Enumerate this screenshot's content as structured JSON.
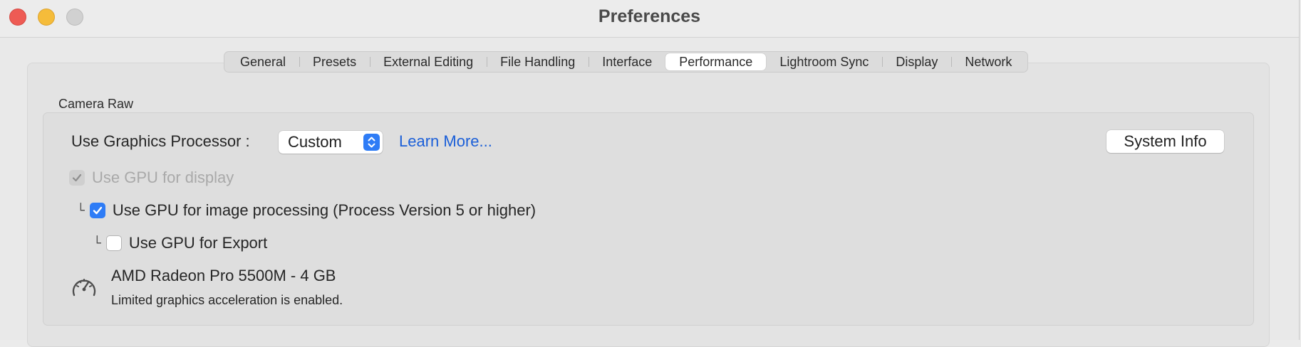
{
  "window": {
    "title": "Preferences",
    "controls": {
      "close_color": "#ee5b54",
      "minimize_color": "#f5bc3a",
      "zoom_color": "#d1d1d1"
    }
  },
  "tabs": [
    {
      "label": "General",
      "active": false
    },
    {
      "label": "Presets",
      "active": false
    },
    {
      "label": "External Editing",
      "active": false
    },
    {
      "label": "File Handling",
      "active": false
    },
    {
      "label": "Interface",
      "active": false
    },
    {
      "label": "Performance",
      "active": true
    },
    {
      "label": "Lightroom Sync",
      "active": false
    },
    {
      "label": "Display",
      "active": false
    },
    {
      "label": "Network",
      "active": false
    }
  ],
  "camera_raw": {
    "group_label": "Camera Raw",
    "graphics_processor": {
      "label": "Use Graphics Processor :",
      "selected": "Custom",
      "learn_more": "Learn More...",
      "system_info": "System Info"
    },
    "options": {
      "display": {
        "label": "Use GPU for display",
        "checked": true,
        "enabled": false
      },
      "image_processing": {
        "label": "Use GPU for image processing (Process Version 5 or higher)",
        "checked": true,
        "enabled": true
      },
      "export": {
        "label": "Use GPU for Export",
        "checked": false,
        "enabled": true
      }
    },
    "gpu": {
      "name": "AMD Radeon Pro 5500M - 4 GB",
      "status": "Limited graphics acceleration is enabled.",
      "icon": "gauge-icon"
    }
  },
  "colors": {
    "accent": "#2e7cf6",
    "link": "#1b5fd8"
  }
}
